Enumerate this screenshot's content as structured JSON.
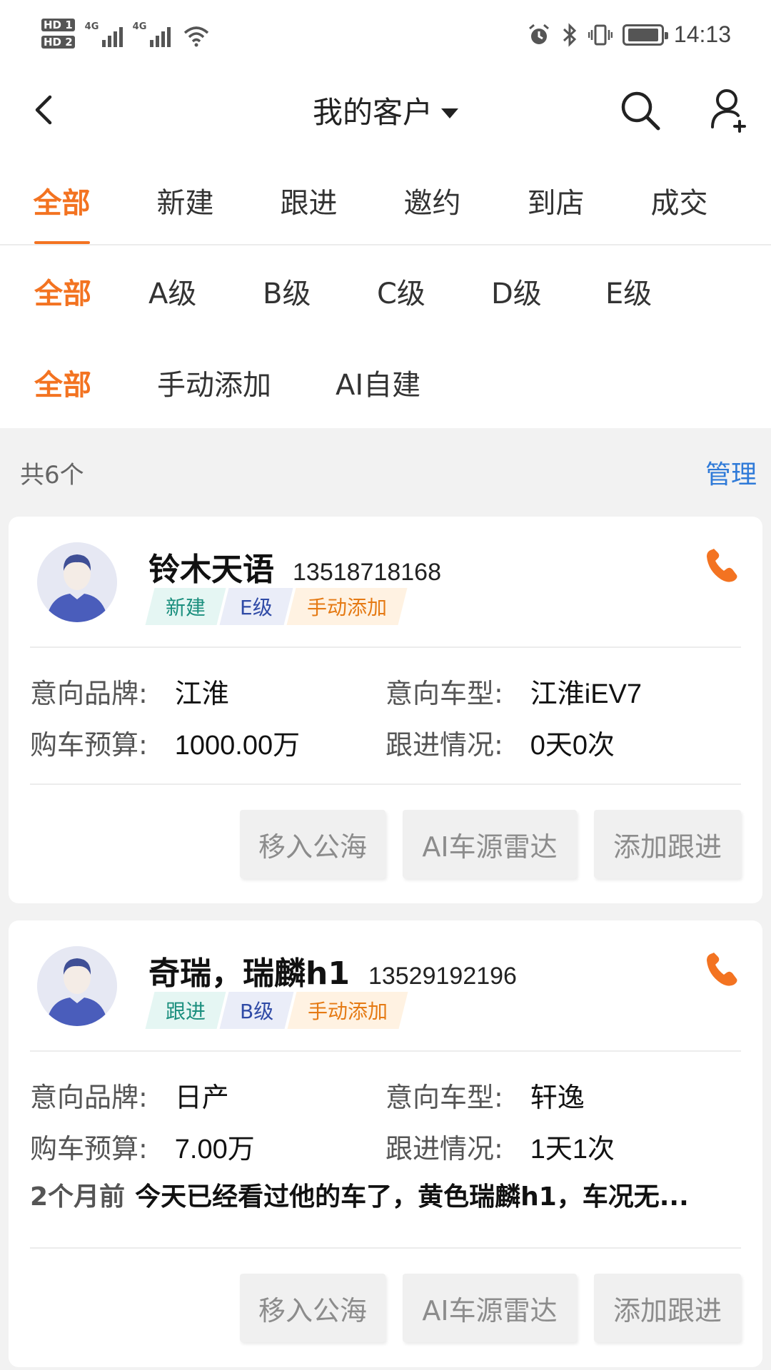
{
  "status_bar": {
    "left_badges": [
      "HD 1",
      "HD 2"
    ],
    "signal_labels": [
      "4G",
      "4G"
    ],
    "time": "14:13"
  },
  "header": {
    "title": "我的客户"
  },
  "stage_tabs": [
    "全部",
    "新建",
    "跟进",
    "邀约",
    "到店",
    "成交"
  ],
  "level_filters": [
    "全部",
    "A级",
    "B级",
    "C级",
    "D级",
    "E级"
  ],
  "source_filters": [
    "全部",
    "手动添加",
    "AI自建"
  ],
  "count_bar": {
    "count": "共6个",
    "manage": "管理"
  },
  "labels": {
    "brand": "意向品牌:",
    "model": "意向车型:",
    "budget": "购车预算:",
    "followup": "跟进情况:"
  },
  "actions": {
    "move_to_pool": "移入公海",
    "ai_radar": "AI车源雷达",
    "add_followup": "添加跟进"
  },
  "customers": [
    {
      "name": "铃木天语",
      "phone": "13518718168",
      "tags": {
        "status": "新建",
        "level": "E级",
        "source": "手动添加"
      },
      "brand": "江淮",
      "model": "江淮iEV7",
      "budget": "1000.00万",
      "followup": "0天0次"
    },
    {
      "name": "奇瑞，瑞麟h1",
      "phone": "13529192196",
      "tags": {
        "status": "跟进",
        "level": "B级",
        "source": "手动添加"
      },
      "brand": "日产",
      "model": "轩逸",
      "budget": "7.00万",
      "followup": "1天1次",
      "note_time": "2个月前",
      "note": "今天已经看过他的车了，黄色瑞麟h1，车况无..."
    }
  ],
  "colors": {
    "accent": "#f37321",
    "link": "#2f7ad8",
    "background": "#f2f2f2"
  },
  "icons": [
    "back-arrow-icon",
    "caret-down-icon",
    "search-icon",
    "add-user-icon",
    "phone-icon",
    "avatar-icon",
    "wifi-icon",
    "alarm-icon",
    "bluetooth-icon",
    "vibrate-icon",
    "battery-icon"
  ]
}
